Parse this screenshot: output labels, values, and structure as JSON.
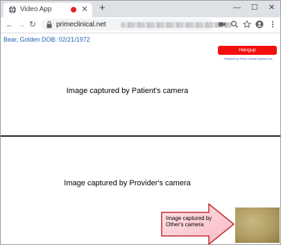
{
  "browser": {
    "tab_title": "Video App",
    "new_tab_symbol": "+",
    "url": "primeclinical.net",
    "controls": {
      "minimize": "—",
      "maximize": "☐",
      "close": "✕"
    }
  },
  "page": {
    "patient_info": "Bear, Golden DOB: 02/21/1972",
    "hangup_label": "Hangup",
    "powered_by": "Powered by Prime Clinical Systems Inc",
    "patient_camera_caption": "Image captured by Patient's camera",
    "provider_camera_caption": "Image captured by Provider's camera",
    "other_camera_caption": "Image captured by Other's camera"
  },
  "colors": {
    "hangup_bg": "#f40f0f",
    "recording_dot": "#e8202a",
    "patient_text": "#1f5fb4",
    "callout_arrow_fill": "#ffd5db",
    "callout_arrow_stroke": "#c12a2a"
  },
  "icons": {
    "tab": "globe-icon",
    "back": "back-arrow-icon",
    "forward": "forward-arrow-icon",
    "reload": "reload-icon",
    "lock": "lock-icon",
    "camera": "camera-icon",
    "zoom": "search-icon",
    "bookmark": "star-icon",
    "profile": "account-icon",
    "menu": "more-vert-icon"
  }
}
